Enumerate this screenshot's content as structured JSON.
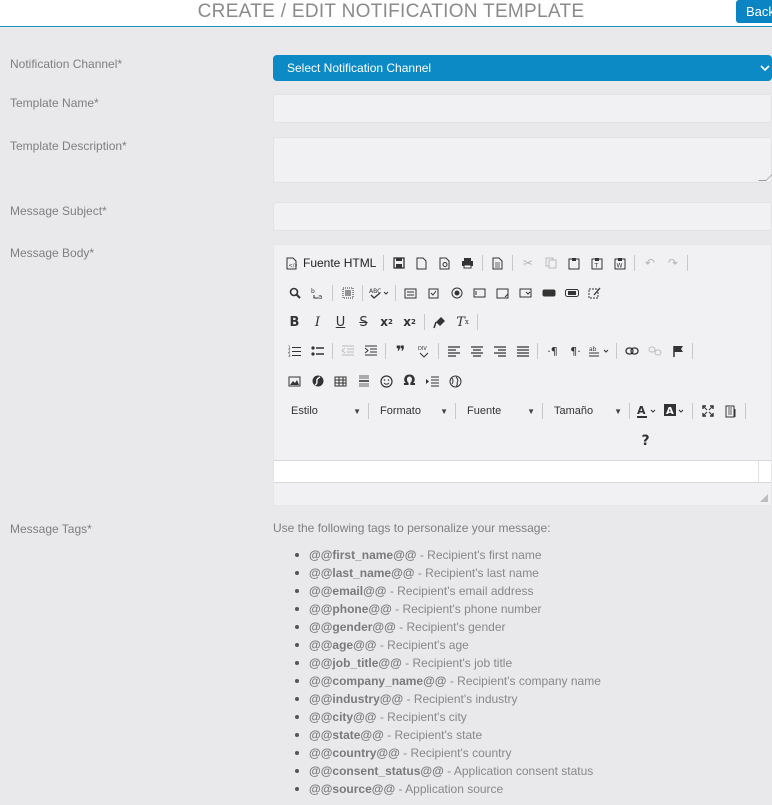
{
  "header": {
    "title": "CREATE / EDIT NOTIFICATION TEMPLATE",
    "back_label": "Back"
  },
  "form": {
    "channel_label": "Notification Channel*",
    "channel_value": "Select Notification Channel",
    "name_label": "Template Name*",
    "description_label": "Template Description*",
    "subject_label": "Message Subject*",
    "body_label": "Message Body*",
    "tags_label": "Message Tags*"
  },
  "editor": {
    "source_button": "Fuente HTML",
    "style_combo": "Estilo",
    "format_combo": "Formato",
    "font_combo": "Fuente",
    "size_combo": "Tamaño",
    "help_button": "?"
  },
  "tags": {
    "intro": "Use the following tags to personalize your message:",
    "items": [
      {
        "tag": "@@first_name@@",
        "desc": " - Recipient's first name"
      },
      {
        "tag": "@@last_name@@",
        "desc": " - Recipient's last name"
      },
      {
        "tag": "@@email@@",
        "desc": " - Recipient's email address"
      },
      {
        "tag": "@@phone@@",
        "desc": " - Recipient's phone number"
      },
      {
        "tag": "@@gender@@",
        "desc": " - Recipient's gender"
      },
      {
        "tag": "@@age@@",
        "desc": " - Recipient's age"
      },
      {
        "tag": "@@job_title@@",
        "desc": " - Recipient's job title"
      },
      {
        "tag": "@@company_name@@",
        "desc": " - Recipient's company name"
      },
      {
        "tag": "@@industry@@",
        "desc": " - Recipient's industry"
      },
      {
        "tag": "@@city@@",
        "desc": " - Recipient's city"
      },
      {
        "tag": "@@state@@",
        "desc": " - Recipient's state"
      },
      {
        "tag": "@@country@@",
        "desc": " - Recipient's country"
      },
      {
        "tag": "@@consent_status@@",
        "desc": " - Application consent status"
      },
      {
        "tag": "@@source@@",
        "desc": " - Application source"
      }
    ]
  },
  "colors": {
    "accent": "#0b8ac6",
    "background": "#e9e9ec"
  }
}
